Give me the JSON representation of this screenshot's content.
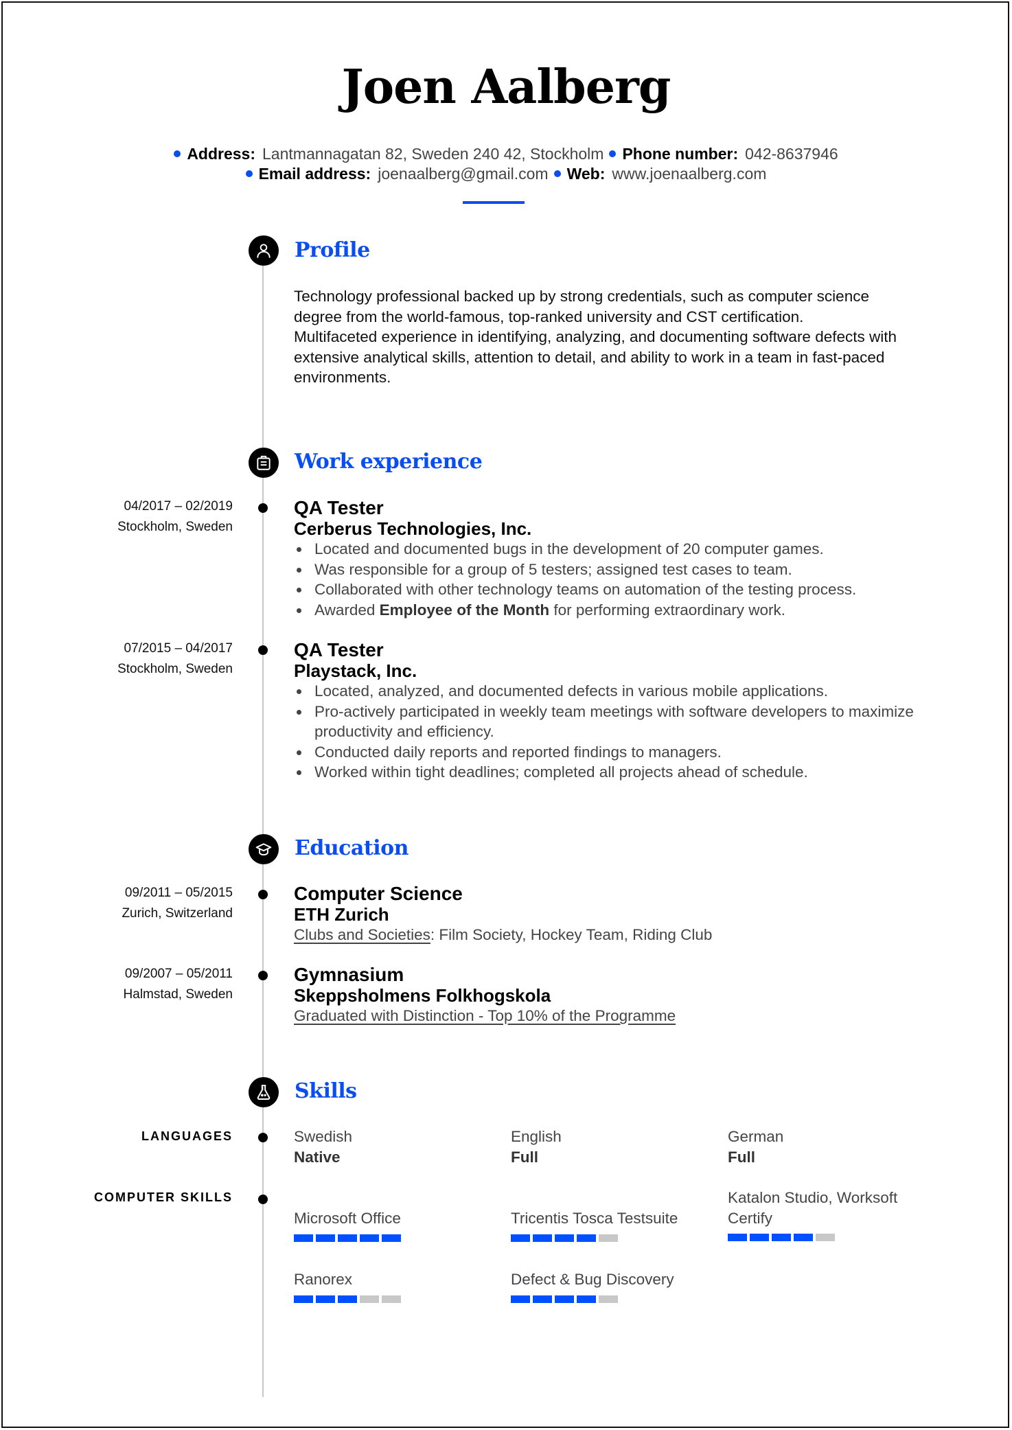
{
  "header": {
    "name": "Joen Aalberg",
    "contact_line1": [
      {
        "label": "Address:",
        "value": "Lantmannagatan 82, Sweden 240 42, Stockholm"
      },
      {
        "label": "Phone number:",
        "value": "042-8637946"
      }
    ],
    "contact_line2": [
      {
        "label": "Email address:",
        "value": "joenaalberg@gmail.com"
      },
      {
        "label": "Web:",
        "value": "www.joenaalberg.com"
      }
    ]
  },
  "colors": {
    "accent": "#0a4ef0",
    "skill_bar_filled": "#0050ff",
    "skill_bar_empty": "#c8c8c8"
  },
  "profile": {
    "title": "Profile",
    "icon": "user-icon",
    "lines": [
      "Technology professional backed up by strong credentials, such as computer science",
      "degree from the world-famous, top-ranked university and CST certification.",
      "Multifaceted experience in identifying, analyzing, and documenting software defects with",
      "extensive analytical skills, attention to detail, and ability to work in a team in fast-paced",
      "environments."
    ]
  },
  "work": {
    "title": "Work experience",
    "icon": "briefcase-icon",
    "jobs": [
      {
        "dates": "04/2017 – 02/2019",
        "location": "Stockholm, Sweden",
        "role": "QA Tester",
        "company": "Cerberus Technologies, Inc.",
        "bullets": [
          {
            "pre": "Located and documented bugs in the development of 20 computer games.",
            "bold": "",
            "post": ""
          },
          {
            "pre": "Was responsible for a group of 5 testers; assigned test cases to team.",
            "bold": "",
            "post": ""
          },
          {
            "pre": "Collaborated with other technology teams on automation of the testing process.",
            "bold": "",
            "post": ""
          },
          {
            "pre": "Awarded ",
            "bold": "Employee of the Month",
            "post": " for performing extraordinary work."
          }
        ]
      },
      {
        "dates": "07/2015 – 04/2017",
        "location": "Stockholm, Sweden",
        "role": "QA Tester",
        "company": "Playstack, Inc.",
        "bullets": [
          {
            "pre": "Located, analyzed, and documented defects in various mobile applications.",
            "bold": "",
            "post": ""
          },
          {
            "pre": "Pro-actively participated in weekly team meetings with software developers to maximize productivity and efficiency.",
            "bold": "",
            "post": ""
          },
          {
            "pre": "Conducted daily reports and reported findings to managers.",
            "bold": "",
            "post": ""
          },
          {
            "pre": "Worked within tight deadlines; completed all projects ahead of schedule.",
            "bold": "",
            "post": ""
          }
        ]
      }
    ]
  },
  "education": {
    "title": "Education",
    "icon": "graduation-cap-icon",
    "items": [
      {
        "dates": "09/2011 – 05/2015",
        "location": "Zurich, Switzerland",
        "degree": "Computer Science",
        "school": "ETH Zurich",
        "note_underlined": "Clubs and Societies",
        "note_rest": ": Film Society, Hockey Team, Riding Club"
      },
      {
        "dates": "09/2007 – 05/2011",
        "location": "Halmstad, Sweden",
        "degree": "Gymnasium",
        "school": "Skeppsholmens Folkhogskola",
        "note_underlined": "Graduated with Distinction - Top 10% of the Programme",
        "note_rest": ""
      }
    ]
  },
  "skills": {
    "title": "Skills",
    "icon": "flask-icon",
    "languages_label": "LANGUAGES",
    "languages": [
      {
        "name": "Swedish",
        "level": "Native"
      },
      {
        "name": "English",
        "level": "Full"
      },
      {
        "name": "German",
        "level": "Full"
      }
    ],
    "computer_label": "COMPUTER SKILLS",
    "computer": [
      {
        "name": "Microsoft Office",
        "rating": 5,
        "max": 5
      },
      {
        "name": "Tricentis Tosca Testsuite",
        "rating": 4,
        "max": 5
      },
      {
        "name": "Katalon Studio, Worksoft Certify",
        "rating": 4,
        "max": 5
      },
      {
        "name": "Ranorex",
        "rating": 3,
        "max": 5
      },
      {
        "name": "Defect & Bug Discovery",
        "rating": 4,
        "max": 5
      }
    ]
  }
}
